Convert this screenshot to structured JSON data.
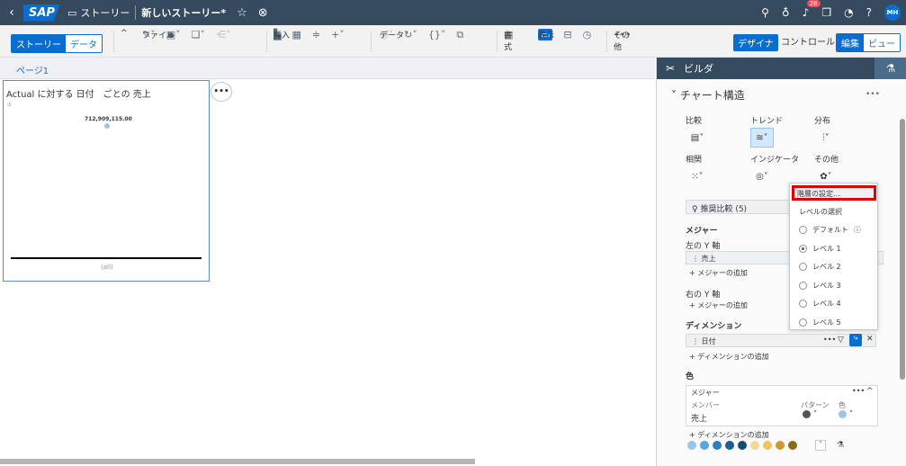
{
  "shell": {
    "logo": "SAP",
    "story_label": "ストーリー",
    "title": "新しいストーリー*",
    "notification_count": "28",
    "avatar_initials": "MH"
  },
  "toolbar": {
    "story_tab": "ストーリー",
    "data_tab": "データ",
    "file_label": "ファイル",
    "insert_label": "挿入",
    "data_label": "データ",
    "format_label": "書式",
    "view_label": "表示",
    "other_label": "その他",
    "designer_btn": "デザイナ",
    "control_btn": "コントロール",
    "edit_tab": "編集",
    "view_tab": "ビュー"
  },
  "page": {
    "tab_label": "ページ1"
  },
  "widget": {
    "title": "Actual に対する 日付　ごとの 売上",
    "value": "712,909,115.00",
    "axis_label": "(all)"
  },
  "builder": {
    "header": "ビルダ",
    "section": "チャート構造",
    "chart_types": [
      {
        "label": "比較"
      },
      {
        "label": "トレンド"
      },
      {
        "label": "分布"
      },
      {
        "label": "相関"
      },
      {
        "label": "インジケータ"
      },
      {
        "label": "その他"
      }
    ],
    "recommend": "推奨比較 (5)",
    "measure_header": "メジャー",
    "left_y": "左の Y 軸",
    "measure_field": "売上",
    "add_measure": "+ メジャーの追加",
    "right_y": "右の Y 軸",
    "add_measure2": "+ メジャーの追加",
    "dimension_header": "ディメンション",
    "dimension_field": "日付",
    "add_dimension": "+ ディメンションの追加",
    "color_header": "色",
    "color_measure": "メジャー",
    "color_member": "メンバー",
    "color_pattern": "パターン",
    "color_color": "色",
    "color_value": "売上",
    "add_dimension2": "+ ディメンションの追加"
  },
  "popover": {
    "highlight": "階層の設定...",
    "heading": "レベルの選択",
    "options": [
      "デフォルト",
      "レベル 1",
      "レベル 2",
      "レベル 3",
      "レベル 4",
      "レベル 5"
    ],
    "selected_index": 1
  },
  "palette": [
    "#9dc3e6",
    "#5ba3d9",
    "#2d7fc1",
    "#1c5f94",
    "#154b72",
    "#f5d898",
    "#edc55f",
    "#c89b32",
    "#8c6a1c"
  ]
}
